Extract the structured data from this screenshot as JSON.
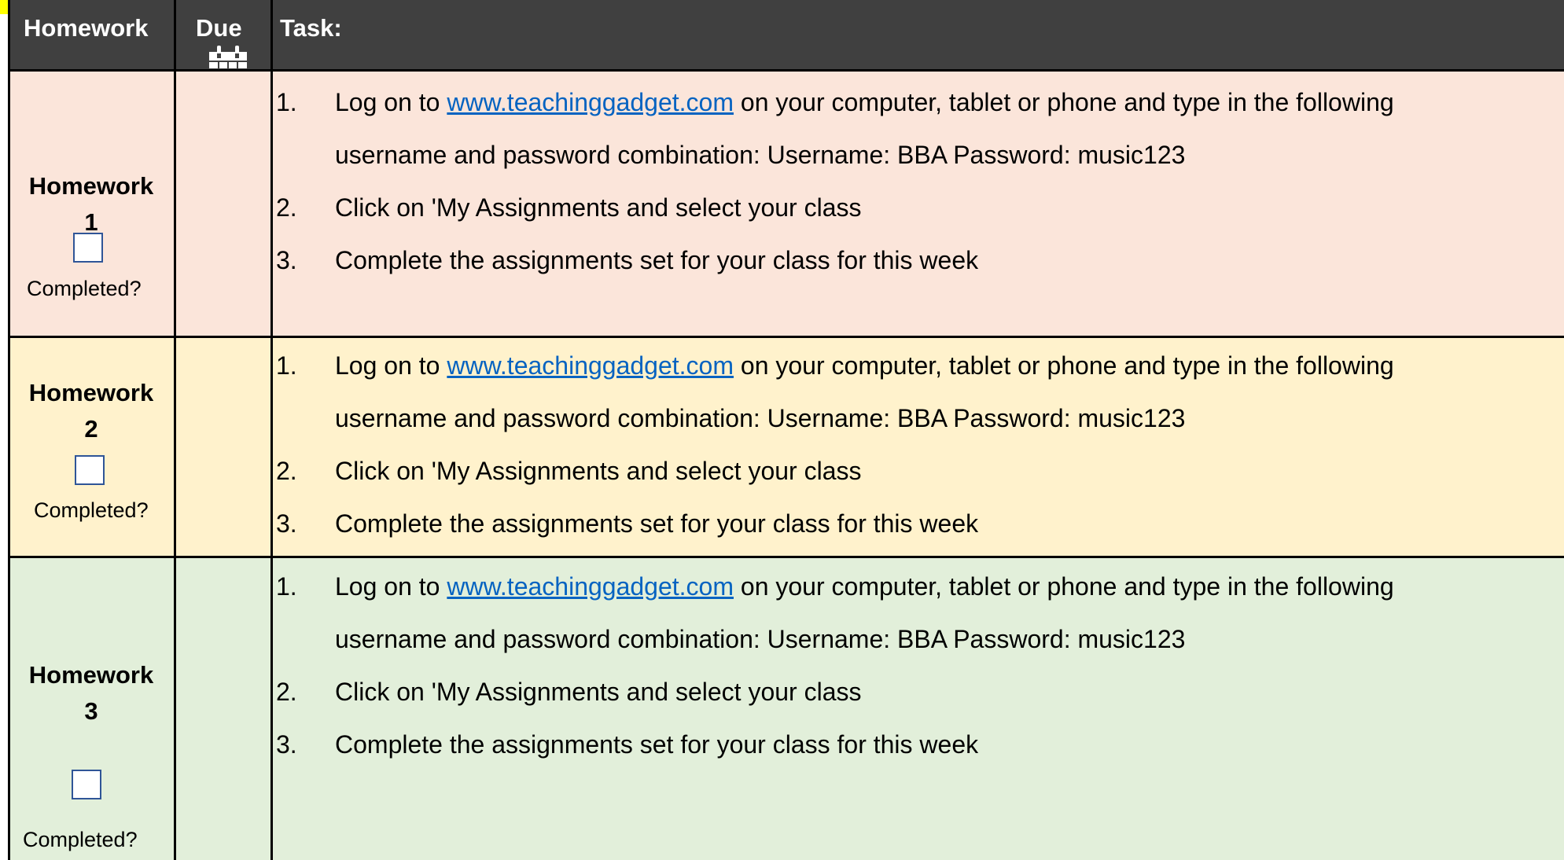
{
  "header": {
    "col_homework": "Homework",
    "col_due": "Due",
    "col_task": "Task:",
    "calendar_icon": "calendar-icon"
  },
  "homeworks": [
    {
      "label_line1": "Homework",
      "label_line2": "1",
      "completed_label": "Completed?",
      "due": "",
      "background": "#fbe5da",
      "tasks": {
        "t1_num": "1.",
        "t1_before": "Log on to ",
        "t1_link": "www.teachinggadget.com",
        "t1_after": " on your computer, tablet or phone and type in the following",
        "t1_cont": "username and password combination: Username: BBA   Password: music123",
        "t2_num": "2.",
        "t2_text": "Click on 'My Assignments and select your class",
        "t3_num": "3.",
        "t3_text": "Complete the assignments set for your class for this week"
      }
    },
    {
      "label_line1": "Homework",
      "label_line2": "2",
      "completed_label": "Completed?",
      "due": "",
      "background": "#fff2cc",
      "tasks": {
        "t1_num": "1.",
        "t1_before": "Log on to ",
        "t1_link": "www.teachinggadget.com",
        "t1_after": " on your computer, tablet or phone and type in the following",
        "t1_cont": "username and password combination: Username: BBA   Password: music123",
        "t2_num": "2.",
        "t2_text": "Click on 'My Assignments and select your class",
        "t3_num": "3.",
        "t3_text": "Complete the assignments set for your class for this week"
      }
    },
    {
      "label_line1": "Homework",
      "label_line2": "3",
      "completed_label": "Completed?",
      "due": "",
      "background": "#e2efda",
      "tasks": {
        "t1_num": "1.",
        "t1_before": "Log on to ",
        "t1_link": "www.teachinggadget.com",
        "t1_after": " on your computer, tablet or phone and type in the following",
        "t1_cont": "username and password combination: Username: BBA   Password: music123",
        "t2_num": "2.",
        "t2_text": "Click on 'My Assignments and select your class",
        "t3_num": "3.",
        "t3_text": "Complete the assignments set for your class for this week"
      }
    }
  ],
  "colors": {
    "header_bg": "#404040",
    "header_text": "#ffffff",
    "top_strip": "#ffff00",
    "link": "#0563c1",
    "checkbox_border": "#2f5597"
  }
}
